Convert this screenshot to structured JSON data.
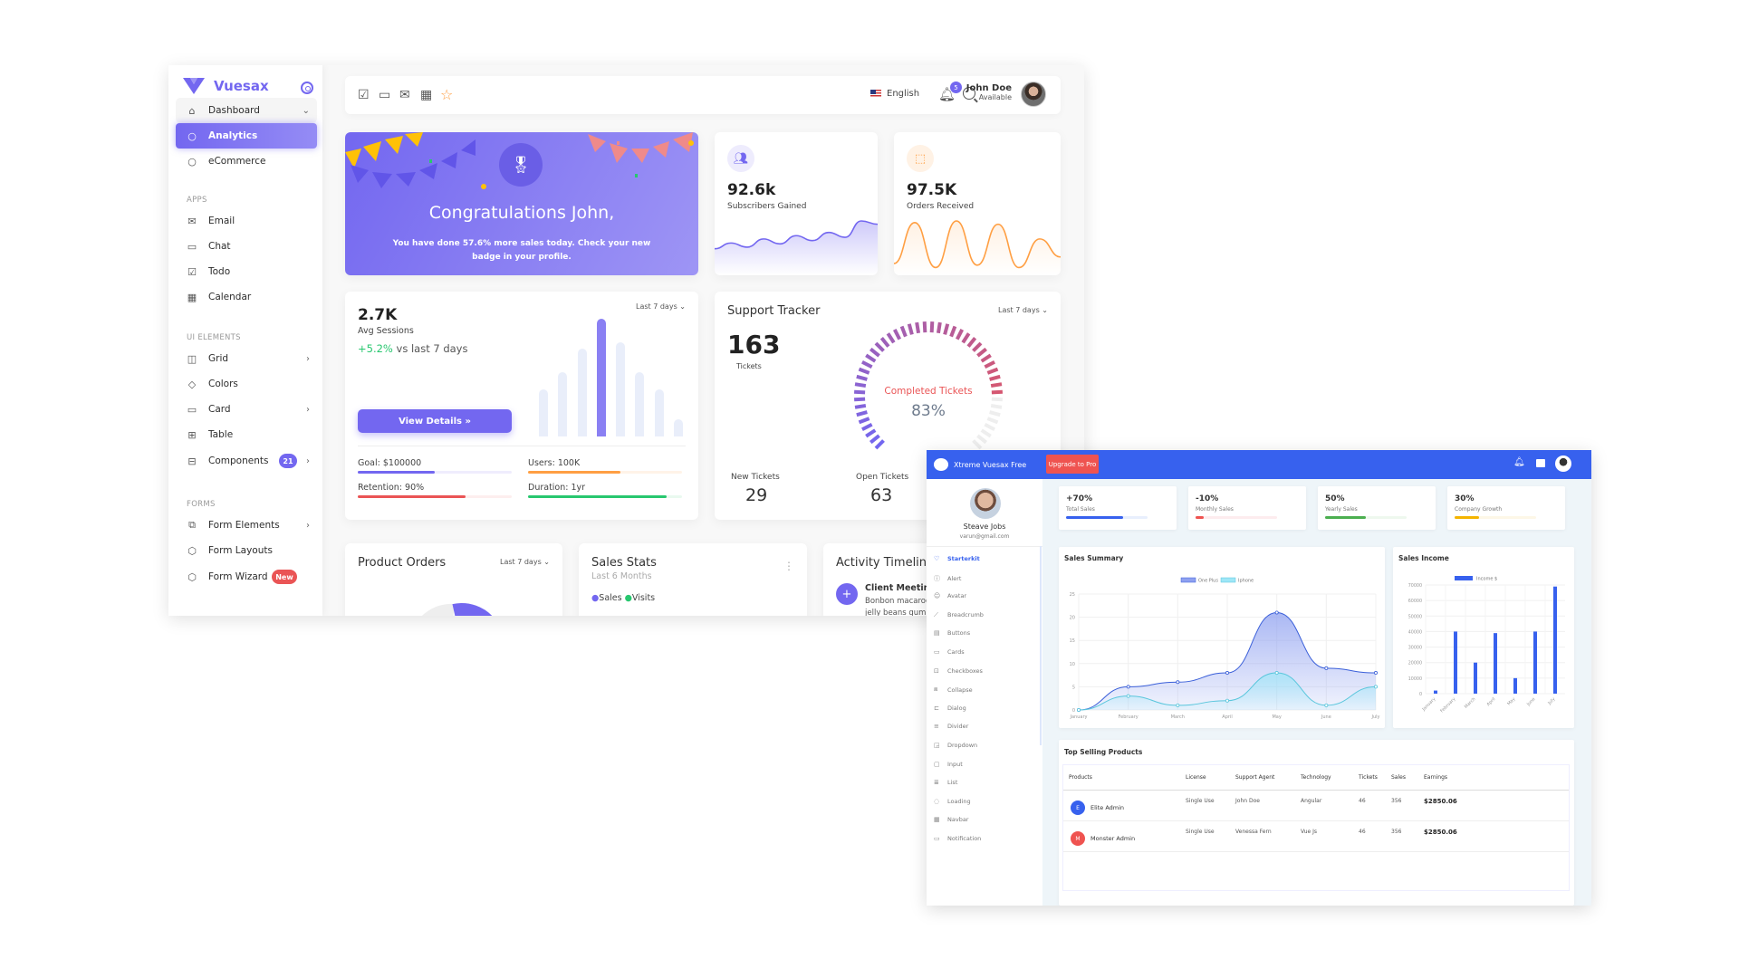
{
  "vuesax": {
    "brand": "Vuesax",
    "sidebar": {
      "dashboard": "Dashboard",
      "analytics": "Analytics",
      "ecommerce": "eCommerce",
      "apps_header": "APPS",
      "apps": [
        "Email",
        "Chat",
        "Todo",
        "Calendar"
      ],
      "ui_header": "UI ELEMENTS",
      "ui": [
        "Grid",
        "Colors",
        "Card",
        "Table",
        "Components"
      ],
      "components_badge": "21",
      "forms_header": "FORMS",
      "forms": [
        "Form Elements",
        "Form Layouts",
        "Form Wizard"
      ],
      "wizard_badge": "New"
    },
    "navbar": {
      "language": "English",
      "notification_count": "5",
      "user_name": "John Doe",
      "user_status": "Available"
    },
    "congrats": {
      "title": "Congratulations John,",
      "subtitle": "You have done 57.6% more sales today. Check your new badge in your profile."
    },
    "subscribers": {
      "value": "92.6k",
      "label": "Subscribers Gained",
      "series": [
        28,
        35,
        30,
        40,
        34,
        44,
        38,
        48,
        42,
        62,
        58
      ]
    },
    "orders": {
      "value": "97.5K",
      "label": "Orders Received",
      "series": [
        10,
        60,
        5,
        62,
        8,
        58,
        5,
        40,
        18
      ]
    },
    "sessions": {
      "value": "2.7K",
      "label": "Avg Sessions",
      "change": "+5.2%",
      "change_suffix": "vs last 7 days",
      "period": "Last 7 days",
      "button": "View Details",
      "bars": [
        40,
        55,
        75,
        100,
        80,
        55,
        40,
        15
      ],
      "highlight_index": 3,
      "goal": "Goal: $100000",
      "goal_progress": 50,
      "users": "Users: 100K",
      "users_progress": 60,
      "retention": "Retention: 90%",
      "retention_progress": 70,
      "duration": "Duration: 1yr",
      "duration_progress": 90
    },
    "support": {
      "title": "Support Tracker",
      "period": "Last 7 days",
      "total": "163",
      "total_label": "Tickets",
      "completed_label": "Completed Tickets",
      "completed_percent": "83%",
      "completed_value": 83,
      "new_label": "New Tickets",
      "new_value": "29",
      "open_label": "Open Tickets",
      "open_value": "63"
    },
    "product_orders": {
      "title": "Product Orders",
      "period": "Last 7 days"
    },
    "sales_stats": {
      "title": "Sales Stats",
      "subtitle": "Last 6 Months",
      "legend": [
        "Sales",
        "Visits"
      ]
    },
    "activity": {
      "title": "Activity Timeline",
      "item_title": "Client Meeting",
      "item_text": "Bonbon macaroon jelly beans gummi bears jelly"
    }
  },
  "xtreme": {
    "brand": "Xtreme Vuesax Free",
    "upgrade": "Upgrade to Pro",
    "profile": {
      "name": "Steave Jobs",
      "email": "varun@gmail.com"
    },
    "nav": [
      "Starterkit",
      "Alert",
      "Avatar",
      "Breadcrumb",
      "Buttons",
      "Cards",
      "Checkboxes",
      "Collapse",
      "Dialog",
      "Divider",
      "Dropdown",
      "Input",
      "List",
      "Loading",
      "Navbar",
      "Notification"
    ],
    "kpis": [
      {
        "value": "+70%",
        "label": "Total Sales",
        "progress": 70,
        "color": "#3761ee",
        "track": "#e8effd"
      },
      {
        "value": "-10%",
        "label": "Monthly Sales",
        "progress": 10,
        "color": "#ef5350",
        "track": "#fdecee"
      },
      {
        "value": "50%",
        "label": "Yearly Sales",
        "progress": 50,
        "color": "#4caf50",
        "track": "#eef8ee"
      },
      {
        "value": "30%",
        "label": "Company Growth",
        "progress": 30,
        "color": "#f4b400",
        "track": "#fdf7e7"
      }
    ],
    "table": {
      "title": "Top Selling Products",
      "headers": [
        "Products",
        "License",
        "Support Agent",
        "Technology",
        "Tickets",
        "Sales",
        "Earnings"
      ],
      "rows": [
        {
          "initial": "E",
          "color": "#3761ee",
          "product": "Elite Admin",
          "license": "Single Use",
          "agent": "John Doe",
          "tech": "Angular",
          "tickets": "46",
          "sales": "356",
          "earnings": "$2850.06"
        },
        {
          "initial": "M",
          "color": "#ef5350",
          "product": "Monster Admin",
          "license": "Single Use",
          "agent": "Venessa Fern",
          "tech": "Vue Js",
          "tickets": "46",
          "sales": "356",
          "earnings": "$2850.06"
        }
      ]
    }
  },
  "chart_data": [
    {
      "type": "area",
      "title": "Sales Summary",
      "categories": [
        "January",
        "February",
        "March",
        "April",
        "May",
        "June",
        "July"
      ],
      "series": [
        {
          "name": "One Plus",
          "values": [
            0,
            5,
            6,
            8,
            21,
            9,
            8
          ]
        },
        {
          "name": "Iphone",
          "values": [
            0,
            3,
            1,
            2,
            8,
            1,
            5
          ]
        }
      ],
      "ylim": [
        0,
        25
      ],
      "yticks": [
        0,
        5,
        10,
        15,
        20,
        25
      ],
      "legend": "top",
      "grid": true
    },
    {
      "type": "bar",
      "title": "Sales Income",
      "categories": [
        "January",
        "February",
        "March",
        "April",
        "May",
        "June",
        "July"
      ],
      "series": [
        {
          "name": "Income $",
          "values": [
            2000,
            40000,
            20000,
            39000,
            10000,
            40000,
            69000
          ]
        }
      ],
      "ylim": [
        0,
        70000
      ],
      "yticks": [
        0,
        10000,
        20000,
        30000,
        40000,
        50000,
        60000,
        70000
      ],
      "legend": "top",
      "grid": true
    }
  ]
}
